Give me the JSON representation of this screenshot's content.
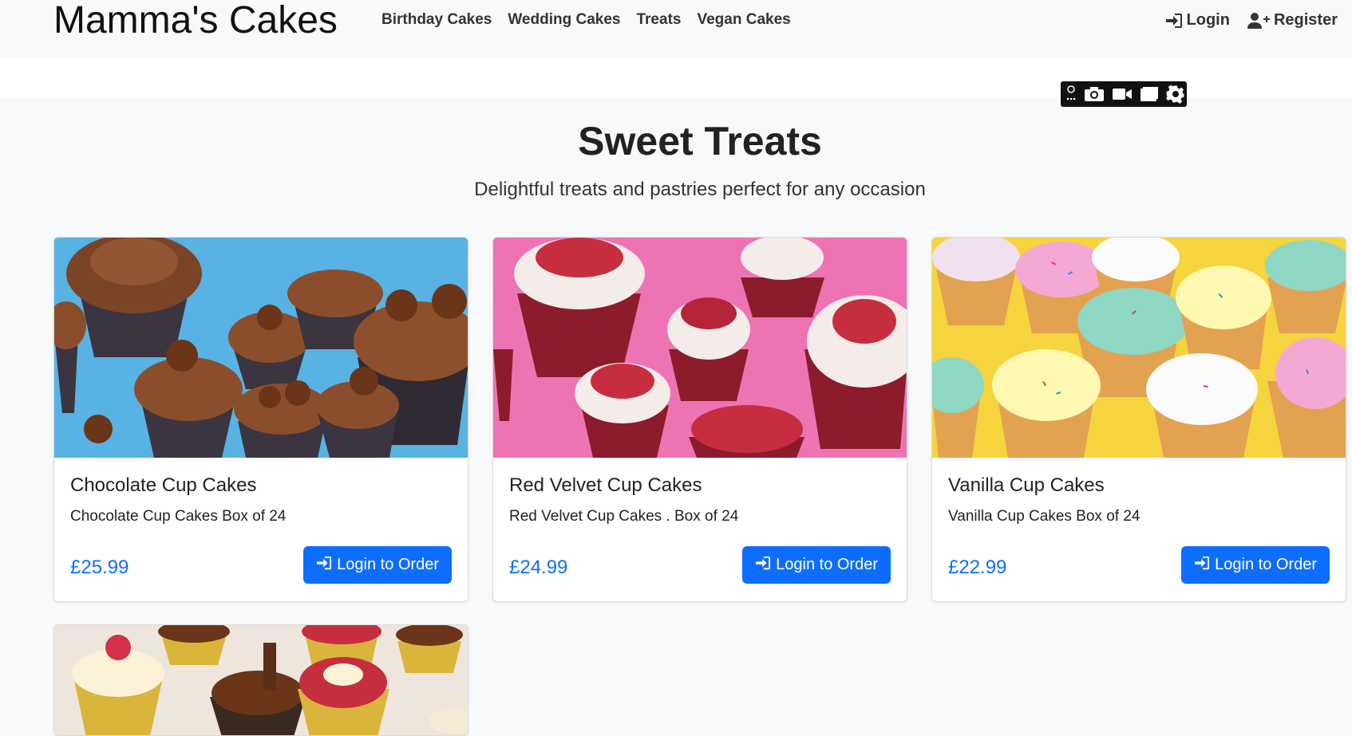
{
  "brand": "Mamma's Cakes",
  "nav": {
    "links": [
      "Birthday Cakes",
      "Wedding Cakes",
      "Treats",
      "Vegan Cakes"
    ],
    "login": "Login",
    "register": "Register"
  },
  "hero": {
    "title": "Sweet Treats",
    "subtitle": "Delightful treats and pastries perfect for any occasion"
  },
  "products": [
    {
      "title": "Chocolate Cup Cakes",
      "description": "Chocolate Cup Cakes Box of 24",
      "price": "£25.99",
      "button": "Login to Order"
    },
    {
      "title": "Red Velvet Cup Cakes",
      "description": "Red Velvet Cup Cakes . Box of 24",
      "price": "£24.99",
      "button": "Login to Order"
    },
    {
      "title": "Vanilla Cup Cakes",
      "description": "Vanilla Cup Cakes Box of 24",
      "price": "£22.99",
      "button": "Login to Order"
    }
  ],
  "icons": {
    "login": "sign-in-icon",
    "register": "user-plus-icon",
    "toolbar": [
      "extension-icon",
      "camera-icon",
      "video-icon",
      "window-icon",
      "gear-icon"
    ]
  },
  "colors": {
    "primary": "#0d6efd",
    "navbar_bg": "#f8f9fa",
    "toolbar_bg": "#111111"
  }
}
